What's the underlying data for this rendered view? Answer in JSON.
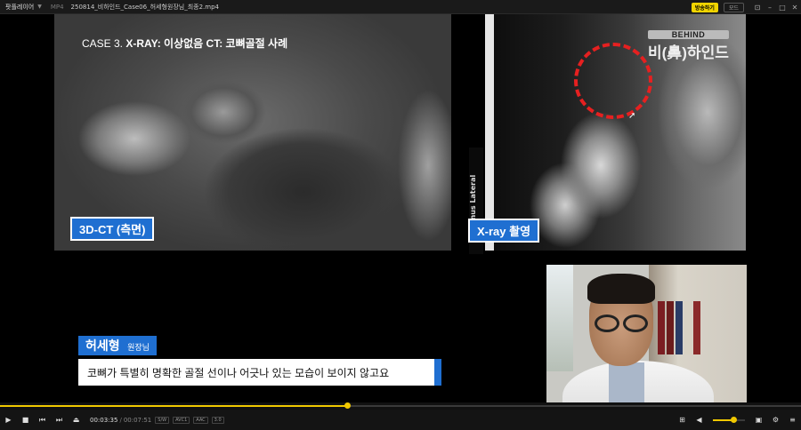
{
  "titlebar": {
    "app_name": "팟플레이어",
    "format": "MP4",
    "file_name": "250814_비하인드_Case06_허세형원장님_최종2.mp4",
    "broadcast_label": "방송하기",
    "mode_label": "모드"
  },
  "video": {
    "case_prefix": "CASE 3.",
    "case_title": "X-RAY: 이상없음 CT: 코뼈골절 사례",
    "tag_ct": "3D-CT (측면)",
    "tag_xray": "X-ray 촬영",
    "sinus_label": "Sinus Lateral",
    "logo_small": "BEHIND",
    "logo_big": "비(鼻)하인드",
    "speaker_name": "허세형",
    "speaker_role": "원장님",
    "subtitle": "코뼈가 특별히 명확한 골절 선이나 어긋나 있는 모습이 보이지 않고요"
  },
  "playback": {
    "current_time": "00:03:35",
    "duration": "00:07:51",
    "progress": 0.433,
    "volume": 0.65,
    "chips": [
      "S/W",
      "AVC1",
      "AAC",
      "3.0"
    ]
  },
  "colors": {
    "accent": "#f0c800",
    "tag_blue": "#1f6fd1",
    "circle_red": "#e62020"
  }
}
